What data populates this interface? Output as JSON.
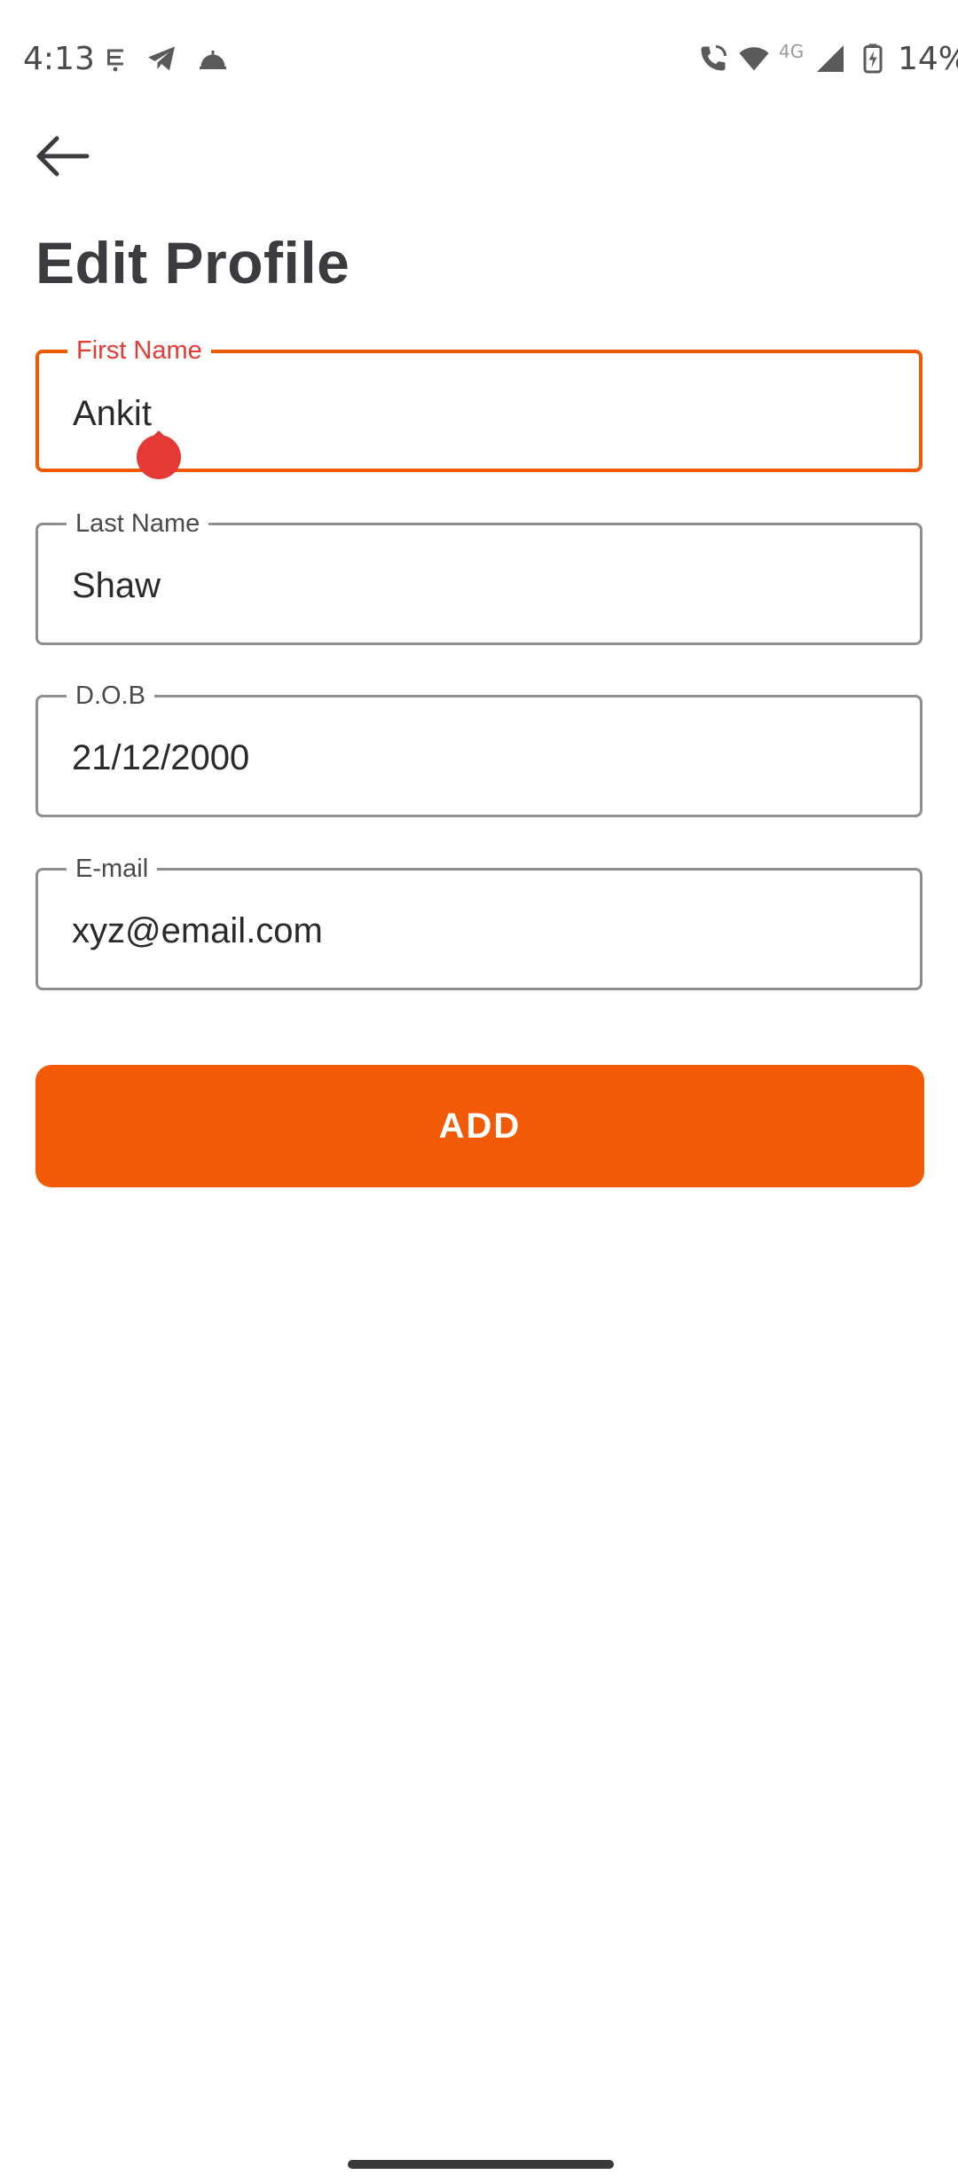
{
  "status_bar": {
    "time": "4:13",
    "network_type": "4G",
    "battery_percent": "14%",
    "left_icons": [
      "notification-app-icon",
      "telegram-icon",
      "delivery-bell-icon"
    ],
    "right_icons": [
      "wifi-call-icon",
      "wifi-icon",
      "signal-icon",
      "battery-charging-icon"
    ]
  },
  "header": {
    "back_icon": "arrow-left-icon",
    "title": "Edit Profile"
  },
  "form": {
    "first_name": {
      "label": "First Name",
      "value": "Ankit"
    },
    "last_name": {
      "label": "Last Name",
      "value": "Shaw"
    },
    "dob": {
      "label": "D.O.B",
      "value": "21/12/2000"
    },
    "email": {
      "label": "E-mail",
      "value": "xyz@email.com"
    }
  },
  "actions": {
    "submit_label": "ADD"
  },
  "colors": {
    "accent": "#f25a05",
    "focused_label": "#e53b32",
    "title": "#3c3c40",
    "field_border": "#8e8e8e"
  }
}
